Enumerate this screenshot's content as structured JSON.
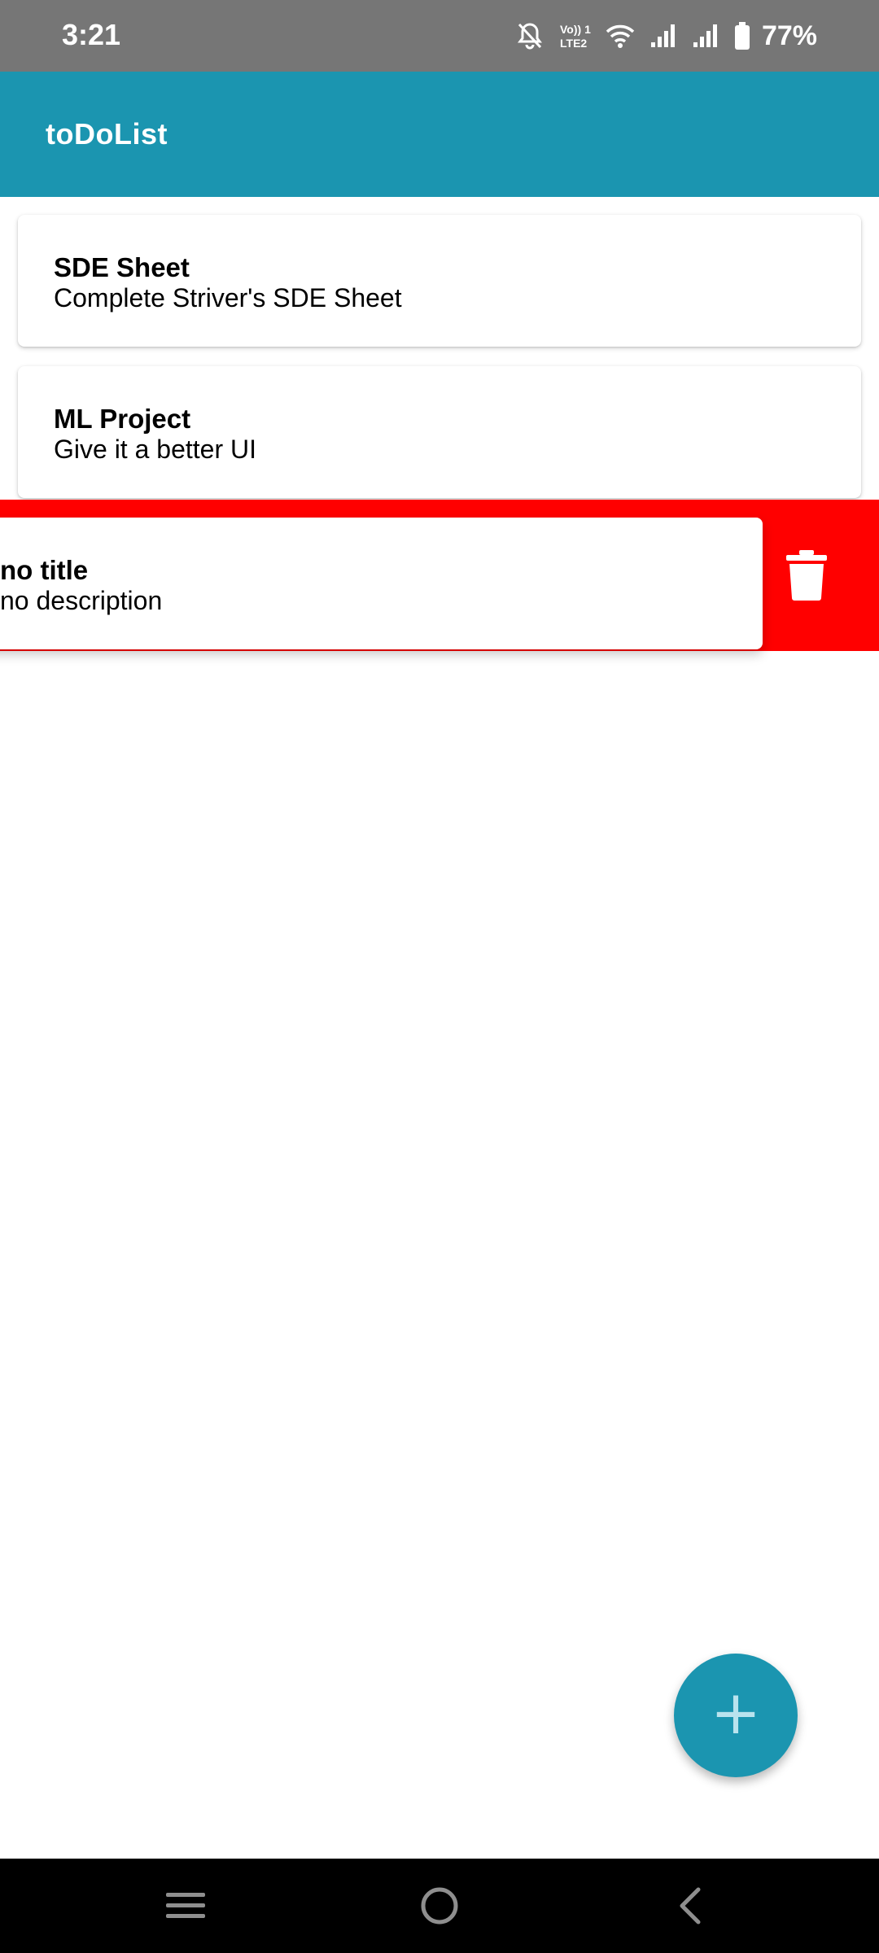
{
  "status_bar": {
    "time": "3:21",
    "battery_percent": "77%",
    "icons": [
      "bell-off-icon",
      "volte-icon",
      "wifi-icon",
      "signal-icon",
      "signal-icon",
      "battery-icon"
    ],
    "volte_line1": "Vo)) 1",
    "volte_line2": "LTE2"
  },
  "app_bar": {
    "title": "toDoList",
    "color": "#1b95b0"
  },
  "todos": [
    {
      "title": "SDE Sheet",
      "description": "Complete Striver's SDE Sheet"
    },
    {
      "title": "ML Project",
      "description": "Give it a better UI"
    },
    {
      "title": "no title",
      "description": "no description",
      "swiping": true
    }
  ],
  "swipe_action": {
    "icon": "trash-icon",
    "color": "#ff0000"
  },
  "fab": {
    "icon": "plus-icon",
    "label": "+"
  },
  "nav_bar": {
    "buttons": [
      "menu-icon",
      "home-icon",
      "back-icon"
    ]
  }
}
